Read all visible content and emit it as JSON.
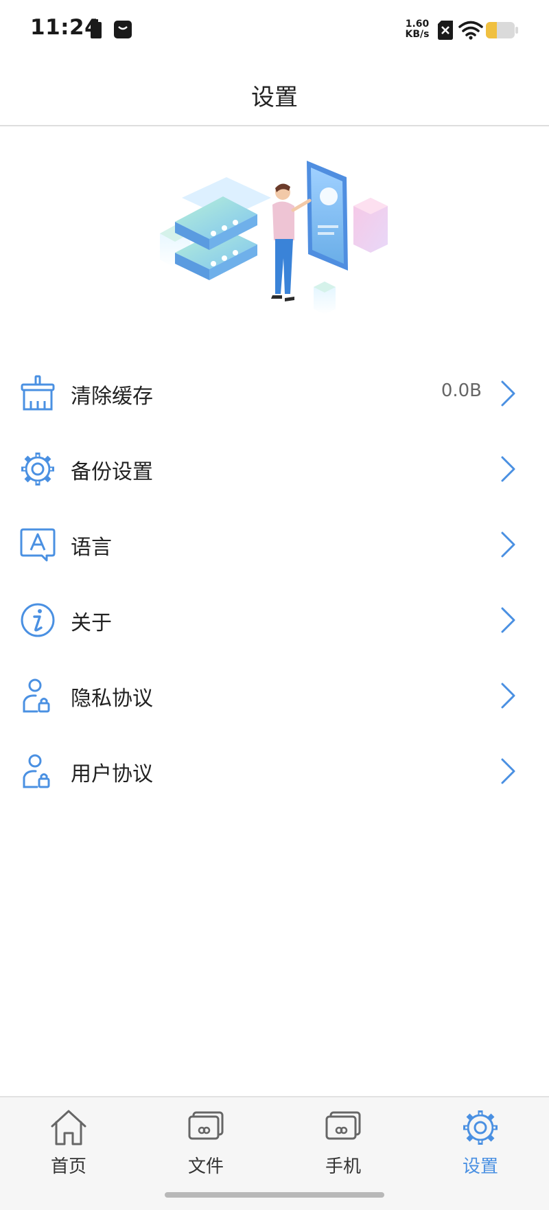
{
  "status_bar": {
    "time": "11:24",
    "net_speed_value": "1.60",
    "net_speed_unit": "KB/s",
    "icons": [
      "battery-saver-icon",
      "app-notification-icon",
      "sim-off-icon",
      "wifi-icon",
      "battery-icon"
    ]
  },
  "header": {
    "title": "设置"
  },
  "hero": {
    "icon": "cloud-backup-illustration"
  },
  "settings": {
    "items": [
      {
        "label": "清除缓存",
        "value": "0.0B",
        "icon": "broom-icon"
      },
      {
        "label": "备份设置",
        "icon": "gear-icon"
      },
      {
        "label": "语言",
        "icon": "language-icon"
      },
      {
        "label": "关于",
        "icon": "info-icon"
      },
      {
        "label": "隐私协议",
        "icon": "user-lock-icon"
      },
      {
        "label": "用户协议",
        "icon": "user-lock-icon"
      }
    ]
  },
  "tabs": [
    {
      "label": "首页",
      "icon": "home-icon"
    },
    {
      "label": "文件",
      "icon": "files-icon"
    },
    {
      "label": "手机",
      "icon": "phone-icon"
    },
    {
      "label": "设置",
      "icon": "settings-icon",
      "active": true
    }
  ],
  "colors": {
    "accent": "#4a90e2",
    "text": "#222222",
    "tab_bar_background": "#f6f6f6"
  }
}
